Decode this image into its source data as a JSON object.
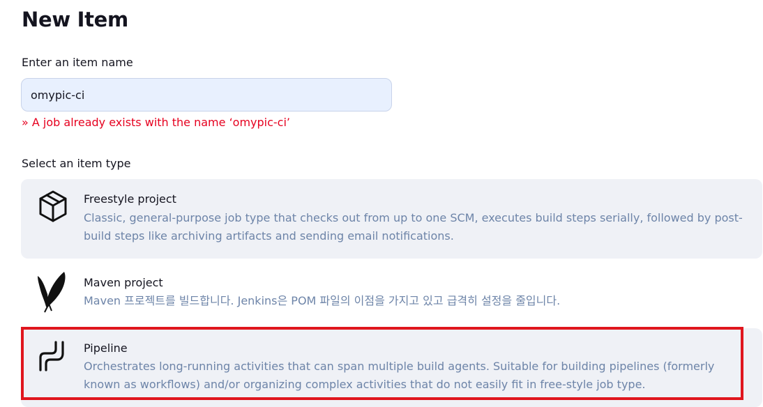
{
  "page": {
    "title": "New Item"
  },
  "name_field": {
    "label": "Enter an item name",
    "value": "omypic-ci",
    "error": "» A job already exists with the name ‘omypic-ci’"
  },
  "item_type": {
    "label": "Select an item type",
    "items": [
      {
        "name": "Freestyle project",
        "description": "Classic, general-purpose job type that checks out from up to one SCM, executes build steps serially, followed by post-build steps like archiving artifacts and sending email notifications.",
        "icon": "package-icon"
      },
      {
        "name": "Maven project",
        "description": "Maven 프로젝트를 빌드합니다. Jenkins은 POM 파일의 이점을 가지고 있고 급격히 설정을 줄입니다.",
        "icon": "maven-feather-icon"
      },
      {
        "name": "Pipeline",
        "description": "Orchestrates long-running activities that can span multiple build agents. Suitable for building pipelines (formerly known as workflows) and/or organizing complex activities that do not easily fit in free-style job type.",
        "icon": "pipeline-icon"
      }
    ]
  },
  "colors": {
    "error": "#e6001f",
    "description": "#6d84a8",
    "card_background": "#eff1f6",
    "input_background": "#e8f0fe",
    "highlight_border": "#e0161e"
  }
}
